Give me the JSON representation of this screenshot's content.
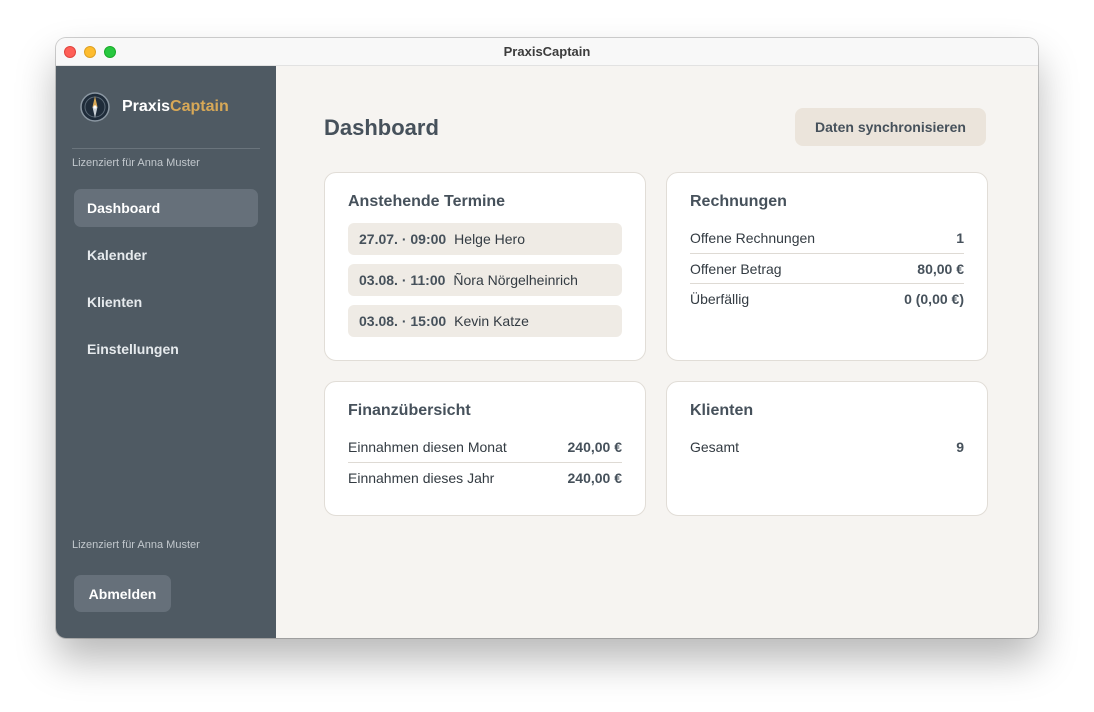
{
  "window": {
    "title": "PraxisCaptain"
  },
  "sidebar": {
    "brand": {
      "part1": "Praxis",
      "part2": "Captain"
    },
    "license_top": "Lizenziert für Anna Muster",
    "license_bottom": "Lizenziert für Anna Muster",
    "items": [
      {
        "label": "Dashboard",
        "active": true
      },
      {
        "label": "Kalender",
        "active": false
      },
      {
        "label": "Klienten",
        "active": false
      },
      {
        "label": "Einstellungen",
        "active": false
      }
    ],
    "logout_label": "Abmelden",
    "logo_icon": "compass-icon"
  },
  "main": {
    "title": "Dashboard",
    "sync_label": "Daten synchronisieren",
    "appointments": {
      "title": "Anstehende Termine",
      "items": [
        {
          "time": "27.07. · 09:00",
          "name": "Helge Hero"
        },
        {
          "time": "03.08. · 11:00",
          "name": "Ñora Nörgelheinrich"
        },
        {
          "time": "03.08. · 15:00",
          "name": "Kevin Katze"
        }
      ]
    },
    "invoices": {
      "title": "Rechnungen",
      "rows": [
        {
          "label": "Offene Rechnungen",
          "value": "1"
        },
        {
          "label": "Offener Betrag",
          "value": "80,00 €"
        },
        {
          "label": "Überfällig",
          "value": "0 (0,00 €)"
        }
      ]
    },
    "finance": {
      "title": "Finanzübersicht",
      "rows": [
        {
          "label": "Einnahmen diesen Monat",
          "value": "240,00 €"
        },
        {
          "label": "Einnahmen dieses Jahr",
          "value": "240,00 €"
        }
      ]
    },
    "clients": {
      "title": "Klienten",
      "rows": [
        {
          "label": "Gesamt",
          "value": "9"
        }
      ]
    }
  },
  "colors": {
    "sidebar_bg": "#4f5a63",
    "brand_accent": "#d7a857",
    "main_bg": "#f6f4f1",
    "text_dark": "#46515b"
  }
}
